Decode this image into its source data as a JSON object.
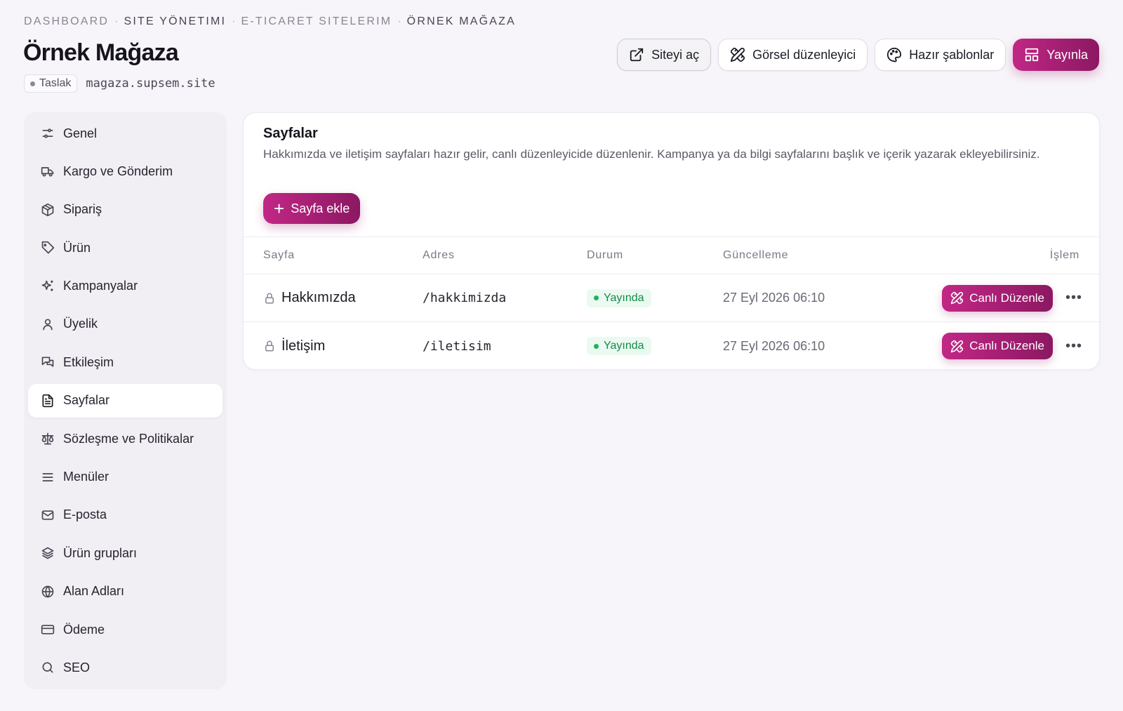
{
  "breadcrumb": [
    "Dashboard",
    "Site Yönetimi",
    "E-Ticaret Sitelerim",
    "Örnek Mağaza"
  ],
  "page": {
    "title": "Örnek Mağaza",
    "status": "Taslak",
    "domain": "magaza.supsem.site"
  },
  "actions": {
    "open_site": "Siteyi aç",
    "visual_editor": "Görsel düzenleyici",
    "templates": "Hazır şablonlar",
    "publish": "Yayınla"
  },
  "sidebar": {
    "active": "Sayfalar",
    "items": [
      {
        "label": "Genel",
        "icon": "sliders-icon"
      },
      {
        "label": "Kargo ve Gönderim",
        "icon": "truck-icon"
      },
      {
        "label": "Sipariş",
        "icon": "box-icon"
      },
      {
        "label": "Ürün",
        "icon": "tag-icon"
      },
      {
        "label": "Kampanyalar",
        "icon": "sparkles-icon"
      },
      {
        "label": "Üyelik",
        "icon": "user-icon"
      },
      {
        "label": "Etkileşim",
        "icon": "chat-icon"
      },
      {
        "label": "Sayfalar",
        "icon": "file-text-icon"
      },
      {
        "label": "Sözleşme ve Politikalar",
        "icon": "scale-icon"
      },
      {
        "label": "Menüler",
        "icon": "menu-icon"
      },
      {
        "label": "E-posta",
        "icon": "mail-icon"
      },
      {
        "label": "Ürün grupları",
        "icon": "layers-icon"
      },
      {
        "label": "Alan Adları",
        "icon": "globe-icon"
      },
      {
        "label": "Ödeme",
        "icon": "credit-card-icon"
      },
      {
        "label": "SEO",
        "icon": "search-icon"
      }
    ]
  },
  "pages_card": {
    "title": "Sayfalar",
    "description": "Hakkımızda ve iletişim sayfaları hazır gelir, canlı düzenleyicide düzenlenir. Kampanya ya da bilgi sayfalarını başlık ve içerik yazarak ekleyebilirsiniz.",
    "add_button": "Sayfa ekle",
    "columns": [
      "Sayfa",
      "Adres",
      "Durum",
      "Güncelleme",
      "İşlem"
    ],
    "rows": [
      {
        "name": "Hakkımızda",
        "path": "/hakkimizda",
        "status": "Yayında",
        "updated": "27 Eyl 2026 06:10",
        "edit": "Canlı Düzenle",
        "more": "•••"
      },
      {
        "name": "İletişim",
        "path": "/iletisim",
        "status": "Yayında",
        "updated": "27 Eyl 2026 06:10",
        "edit": "Canlı Düzenle",
        "more": "•••"
      }
    ]
  },
  "colors": {
    "accent_start": "#c22786",
    "accent_end": "#8b1862",
    "status_green": "#1fb25a",
    "background": "#f7f5f9"
  }
}
